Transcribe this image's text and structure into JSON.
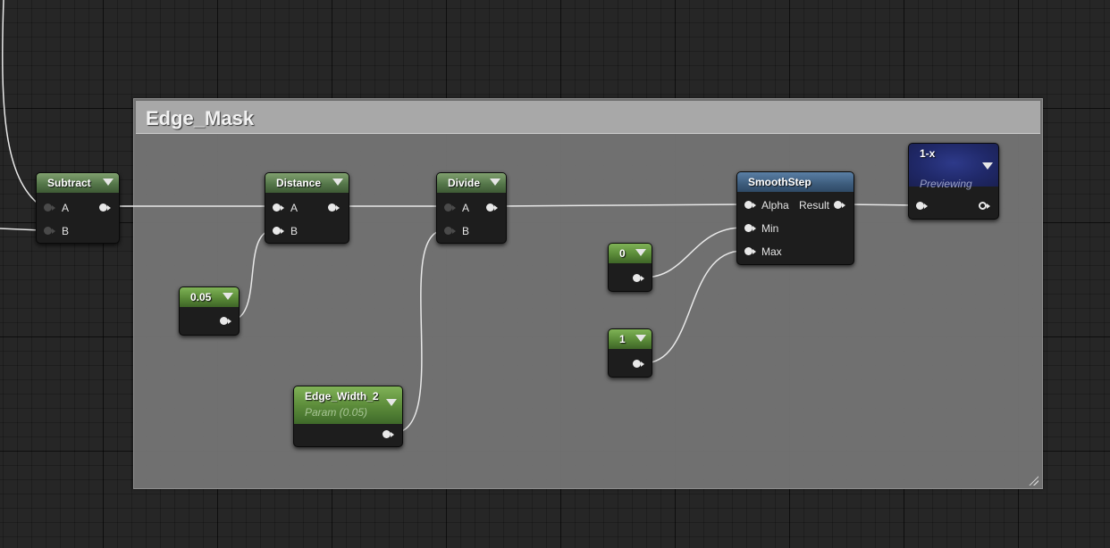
{
  "comment_box": {
    "title": "Edge_Mask"
  },
  "nodes": {
    "subtract": {
      "title": "Subtract",
      "pins": {
        "a": "A",
        "b": "B"
      }
    },
    "distance": {
      "title": "Distance",
      "pins": {
        "a": "A",
        "b": "B"
      }
    },
    "divide": {
      "title": "Divide",
      "pins": {
        "a": "A",
        "b": "B"
      }
    },
    "const_005": {
      "title": "0.05"
    },
    "edge_width": {
      "title": "Edge_Width_2",
      "subtitle": "Param (0.05)"
    },
    "const_0": {
      "title": "0"
    },
    "const_1": {
      "title": "1"
    },
    "smoothstep": {
      "title": "SmoothStep",
      "pins": {
        "alpha": "Alpha",
        "min": "Min",
        "max": "Max",
        "result": "Result"
      }
    },
    "one_minus_x": {
      "title": "1-x",
      "subtitle": "Previewing"
    }
  },
  "colors": {
    "math_node_header": "#55774a",
    "constant_node_header": "#5a8a38",
    "smoothstep_header": "#3d5c7c",
    "preview_node_header": "#20296a",
    "wire": "#e8e8e8",
    "grid_background": "#262626",
    "comment_fill": "#767676"
  }
}
